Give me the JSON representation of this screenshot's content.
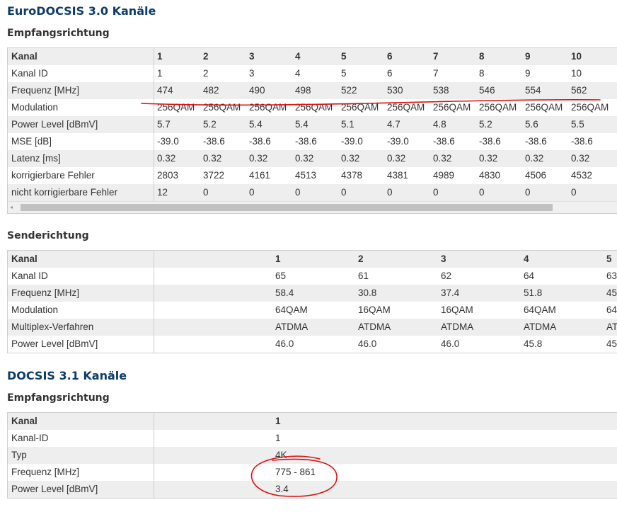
{
  "sections": {
    "euro_title": "EuroDOCSIS 3.0 Kanäle",
    "euro_down_title": "Empfangsrichtung",
    "euro_up_title": "Senderichtung",
    "docsis31_title": "DOCSIS 3.1 Kanäle",
    "docsis31_down_title": "Empfangsrichtung"
  },
  "euro_down": {
    "rows": [
      {
        "label": "Kanal",
        "cells": [
          "1",
          "2",
          "3",
          "4",
          "5",
          "6",
          "7",
          "8",
          "9",
          "10"
        ]
      },
      {
        "label": "Kanal ID",
        "cells": [
          "1",
          "2",
          "3",
          "4",
          "5",
          "6",
          "7",
          "8",
          "9",
          "10"
        ]
      },
      {
        "label": "Frequenz [MHz]",
        "cells": [
          "474",
          "482",
          "490",
          "498",
          "522",
          "530",
          "538",
          "546",
          "554",
          "562"
        ]
      },
      {
        "label": "Modulation",
        "cells": [
          "256QAM",
          "256QAM",
          "256QAM",
          "256QAM",
          "256QAM",
          "256QAM",
          "256QAM",
          "256QAM",
          "256QAM",
          "256QAM"
        ]
      },
      {
        "label": "Power Level [dBmV]",
        "cells": [
          "5.7",
          "5.2",
          "5.4",
          "5.4",
          "5.1",
          "4.7",
          "4.8",
          "5.2",
          "5.6",
          "5.5"
        ]
      },
      {
        "label": "MSE [dB]",
        "cells": [
          "-39.0",
          "-38.6",
          "-38.6",
          "-38.6",
          "-39.0",
          "-39.0",
          "-38.6",
          "-38.6",
          "-38.6",
          "-38.6"
        ]
      },
      {
        "label": "Latenz [ms]",
        "cells": [
          "0.32",
          "0.32",
          "0.32",
          "0.32",
          "0.32",
          "0.32",
          "0.32",
          "0.32",
          "0.32",
          "0.32"
        ]
      },
      {
        "label": "korrigierbare Fehler",
        "cells": [
          "2803",
          "3722",
          "4161",
          "4513",
          "4378",
          "4381",
          "4989",
          "4830",
          "4506",
          "4532"
        ]
      },
      {
        "label": "nicht korrigierbare Fehler",
        "cells": [
          "12",
          "0",
          "0",
          "0",
          "0",
          "0",
          "0",
          "0",
          "0",
          "0"
        ]
      }
    ],
    "scroll_left_icon": "arrow-left-icon"
  },
  "euro_up": {
    "rows": [
      {
        "label": "Kanal",
        "cells": [
          "1",
          "2",
          "3",
          "4",
          "5"
        ]
      },
      {
        "label": "Kanal ID",
        "cells": [
          "65",
          "61",
          "62",
          "64",
          "63"
        ]
      },
      {
        "label": "Frequenz [MHz]",
        "cells": [
          "58.4",
          "30.8",
          "37.4",
          "51.8",
          "45"
        ]
      },
      {
        "label": "Modulation",
        "cells": [
          "64QAM",
          "16QAM",
          "16QAM",
          "64QAM",
          "64"
        ]
      },
      {
        "label": "Multiplex-Verfahren",
        "cells": [
          "ATDMA",
          "ATDMA",
          "ATDMA",
          "ATDMA",
          "AT"
        ]
      },
      {
        "label": "Power Level [dBmV]",
        "cells": [
          "46.0",
          "46.0",
          "46.0",
          "45.8",
          "45"
        ]
      }
    ]
  },
  "docsis31_down": {
    "rows": [
      {
        "label": "Kanal",
        "cells": [
          "1"
        ]
      },
      {
        "label": "Kanal-ID",
        "cells": [
          "1"
        ]
      },
      {
        "label": "Typ",
        "cells": [
          "4K"
        ]
      },
      {
        "label": "Frequenz [MHz]",
        "cells": [
          "775 - 861"
        ]
      },
      {
        "label": "Power Level [dBmV]",
        "cells": [
          "3.4"
        ]
      }
    ]
  },
  "colors": {
    "heading": "#0d3b6a",
    "annotation": "#e01010",
    "alt_row": "#eeeeee"
  }
}
